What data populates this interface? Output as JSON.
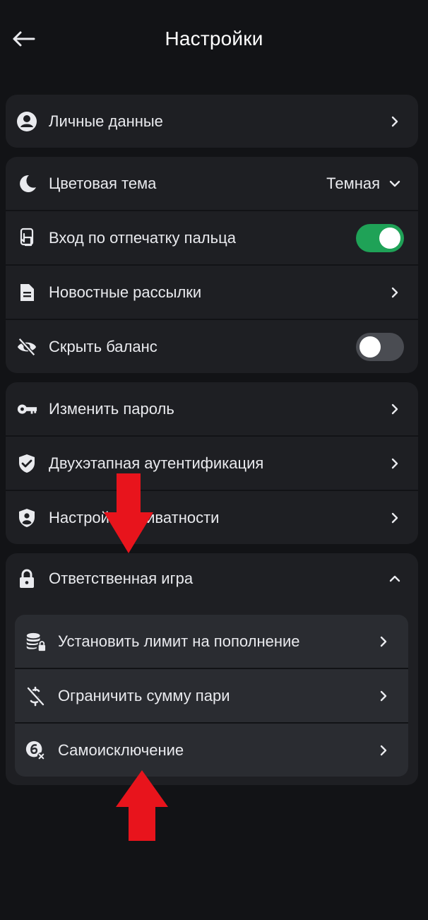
{
  "header": {
    "title": "Настройки",
    "back_icon": "arrow-left-icon"
  },
  "profile": {
    "label": "Личные данные",
    "icon": "account-circle-icon"
  },
  "appearance": {
    "theme_label": "Цветовая тема",
    "theme_value": "Темная",
    "theme_icon": "moon-icon",
    "fingerprint_label": "Вход по отпечатку пальца",
    "fingerprint_enabled": true,
    "fingerprint_icon": "fingerprint-touch-icon",
    "newsletters_label": "Новостные рассылки",
    "newsletters_icon": "document-icon",
    "hide_balance_label": "Скрыть баланс",
    "hide_balance_enabled": false,
    "hide_balance_icon": "eye-off-icon"
  },
  "security": {
    "password_label": "Изменить пароль",
    "password_icon": "key-icon",
    "twofa_label": "Двухэтапная аутентификация",
    "twofa_icon": "shield-check-icon",
    "privacy_label": "Настройки приватности",
    "privacy_icon": "shield-user-icon"
  },
  "responsible": {
    "title": "Ответственная игра",
    "icon": "lock-icon",
    "expanded": true,
    "items": [
      {
        "label": "Установить лимит на пополнение",
        "icon": "coins-lock-icon"
      },
      {
        "label": "Ограничить сумму пари",
        "icon": "dollar-off-icon"
      },
      {
        "label": "Самоисключение",
        "icon": "self-exclusion-icon"
      }
    ]
  },
  "colors": {
    "background": "#121316",
    "card": "#1e1f23",
    "inner_card": "#2a2c31",
    "toggle_on": "#1fa257",
    "toggle_off": "#4a4c52",
    "annotation_arrow": "#e8141c"
  }
}
